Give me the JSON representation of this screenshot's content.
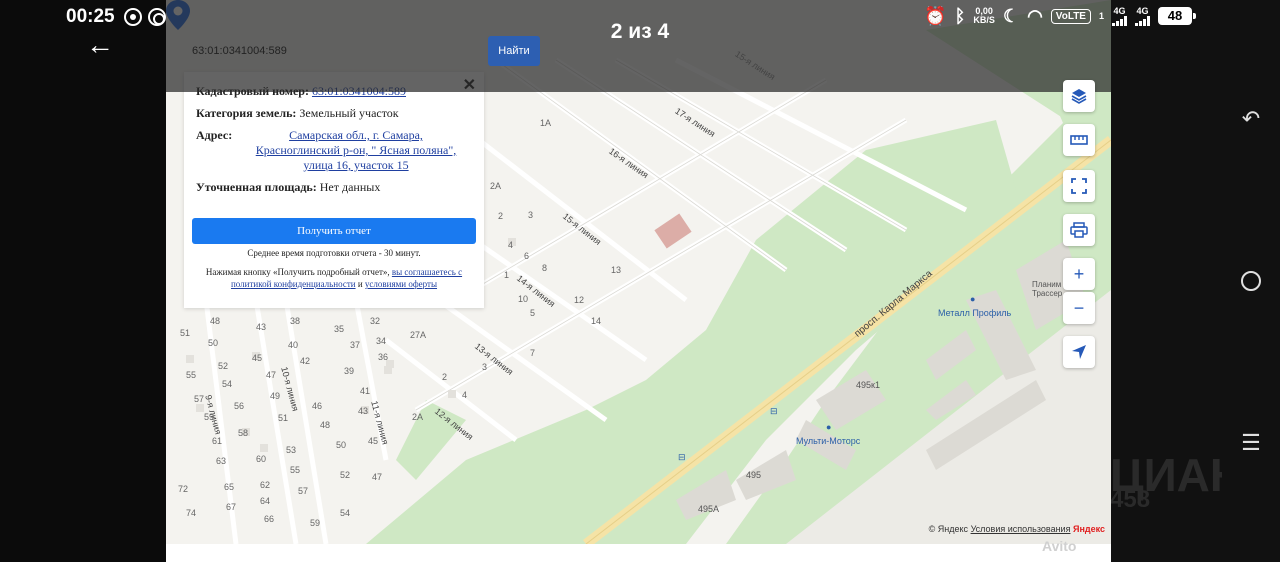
{
  "status_bar": {
    "time": "00:25",
    "net_speed_value": "0,00",
    "net_speed_unit": "KB/S",
    "volte": "VoLTE",
    "sim1": "4G",
    "sim2": "4G",
    "sim1_index": "1",
    "battery": "48"
  },
  "gallery": {
    "counter": "2 из 4"
  },
  "search": {
    "value": "63:01:0341004:589",
    "button": "Найти"
  },
  "popup": {
    "cadastral_label": "Кадастровый номер:",
    "cadastral_value": "63:01:0341004:589",
    "category_label": "Категория земель:",
    "category_value": "Земельный участок",
    "address_label": "Адрес:",
    "address_line1": "Самарская обл., г. Самара,",
    "address_line2": "Красноглинский р-он, \" Ясная поляна\",",
    "address_line3": "улица 16, участок 15",
    "area_label": "Уточненная площадь:",
    "area_value": "Нет данных",
    "report_button": "Получить отчет",
    "report_note": "Среднее время подготовки отчета - 30 минут.",
    "agree_text": "Нажимая кнопку «Получить подробный отчет»,",
    "agree_link1": "вы соглашаетесь с политикой конфиденциальности",
    "agree_and": "и",
    "agree_link2": "условиями оферты"
  },
  "map": {
    "streets": [
      "17-я линия",
      "16-я линия",
      "15-я линия",
      "14-я линия",
      "13-я линия",
      "12-я линия",
      "10-я линия",
      "11-я линия",
      "9-я линия",
      "15-я линия",
      "просп. Карла Маркса"
    ],
    "pois": [
      "Металл Профиль",
      "Мульти-Моторс",
      "Планим Трассер"
    ],
    "buildings": [
      "495к1",
      "495",
      "495А"
    ],
    "house_numbers": [
      "1А",
      "2А",
      "2",
      "3",
      "4",
      "6",
      "8",
      "1",
      "10",
      "12",
      "13",
      "14",
      "5",
      "7",
      "3",
      "2",
      "4",
      "2А",
      "48",
      "43",
      "38",
      "35",
      "32",
      "27А",
      "51",
      "50",
      "40",
      "37",
      "34",
      "55",
      "52",
      "45",
      "42",
      "36",
      "54",
      "47",
      "39",
      "57",
      "49",
      "41",
      "59",
      "56",
      "46",
      "43",
      "58",
      "51",
      "48",
      "61",
      "53",
      "50",
      "45",
      "63",
      "60",
      "55",
      "52",
      "47",
      "72",
      "65",
      "62",
      "57",
      "74",
      "67",
      "64",
      "54",
      "66",
      "59"
    ],
    "attribution_copyright": "© Яндекс",
    "attribution_terms": "Условия использования",
    "attribution_brand": "Яндекс"
  },
  "watermark": {
    "avito": "Avito",
    "bg_text": "ЦИАН",
    "bg_number": "458"
  },
  "controls": {
    "layers": "layers-icon",
    "ruler": "ruler-icon",
    "fullscreen": "fullscreen-icon",
    "print": "print-icon",
    "zoom_in": "+",
    "zoom_out": "−",
    "locate": "locate-icon"
  }
}
